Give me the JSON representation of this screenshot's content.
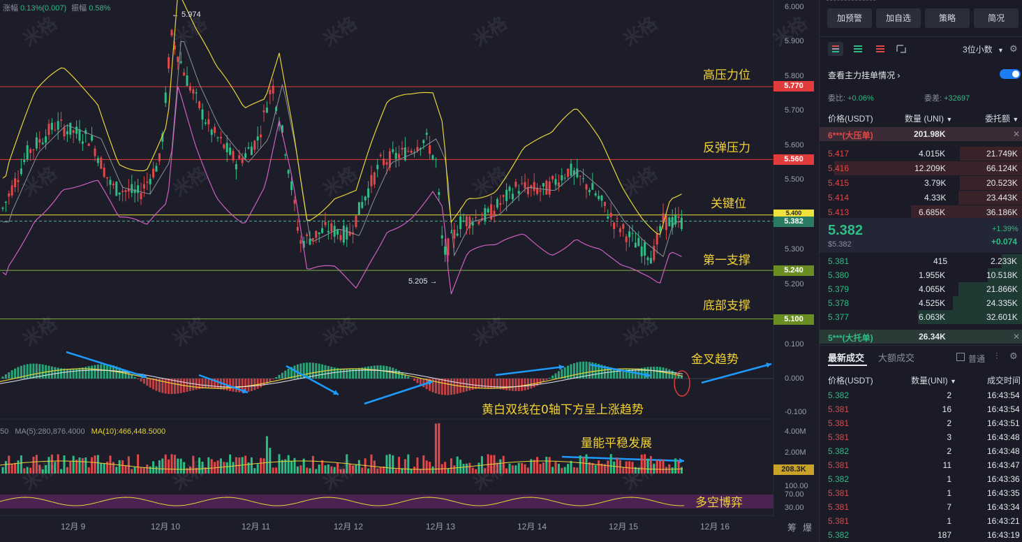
{
  "header": {
    "change_label": "涨幅",
    "change_value": "0.13%(0.007)",
    "amplitude_label": "振幅",
    "amplitude_value": "0.58%"
  },
  "chart": {
    "annotations": {
      "high_resistance": "高压力位",
      "rebound_resistance": "反弹压力",
      "key_level": "关键位",
      "first_support": "第一支撑",
      "bottom_support": "底部支撑",
      "golden_cross": "金叉趋势",
      "macd_note": "黄白双线在0轴下方呈上涨趋势",
      "volume_note": "量能平稳发展",
      "long_short": "多空博弈"
    },
    "high_marker": "← 5.974",
    "low_marker": "5.205 →",
    "price_axis": [
      "6.000",
      "5.900",
      "5.800",
      "5.700",
      "5.600",
      "5.500",
      "5.300",
      "5.200"
    ],
    "price_tags": {
      "p5770": "5.770",
      "p5560": "5.560",
      "p5400": "5.400",
      "p5382": "5.382",
      "p5240": "5.240",
      "p5100": "5.100"
    },
    "macd_axis": [
      "0.100",
      "0.000",
      "-0.100"
    ],
    "volume_legend_left": "50",
    "volume_ma5": "MA(5):280,876.4000",
    "volume_ma10": "MA(10):466,448.5000",
    "volume_axis": [
      "4.00M",
      "2.00M"
    ],
    "volume_tag": "208.3K",
    "kdj_axis": [
      "100.00",
      "70.00",
      "30.00"
    ],
    "x_axis": [
      "12月 9",
      "12月 10",
      "12月 11",
      "12月 12",
      "12月 13",
      "12月 14",
      "12月 15",
      "12月 16"
    ],
    "corner_labels": [
      "筹",
      "爆"
    ],
    "watermark": "米格",
    "colors": {
      "up": "#2dbd85",
      "down": "#e0484a",
      "ma_yellow": "#e8d43a",
      "ma_pink": "#d05fc0",
      "arrow": "#1e9bff"
    }
  },
  "panel": {
    "buttons": [
      "加预警",
      "加自选",
      "策略",
      "简况"
    ],
    "decimal_select": "3位小数",
    "main_orders_link": "查看主力挂单情况",
    "ratio_label": "委比:",
    "ratio_value": "+0.06%",
    "diff_label": "委差:",
    "diff_value": "+32697",
    "book_headers": [
      "价格(USDT)",
      "数量 (UNI)",
      "委托额"
    ],
    "big_ask": {
      "label": "6***(大压单)",
      "qty": "201.98K"
    },
    "asks": [
      {
        "price": "5.417",
        "qty": "4.015K",
        "amount": "21.749K"
      },
      {
        "price": "5.416",
        "qty": "12.209K",
        "amount": "66.124K"
      },
      {
        "price": "5.415",
        "qty": "3.79K",
        "amount": "20.523K"
      },
      {
        "price": "5.414",
        "qty": "4.33K",
        "amount": "23.443K"
      },
      {
        "price": "5.413",
        "qty": "6.685K",
        "amount": "36.186K"
      }
    ],
    "last_price": "5.382",
    "last_price_sub": "$5.382",
    "change_pct": "+1.39%",
    "change_abs": "+0.074",
    "bids": [
      {
        "price": "5.381",
        "qty": "415",
        "amount": "2.233K"
      },
      {
        "price": "5.380",
        "qty": "1.955K",
        "amount": "10.518K"
      },
      {
        "price": "5.379",
        "qty": "4.065K",
        "amount": "21.866K"
      },
      {
        "price": "5.378",
        "qty": "4.525K",
        "amount": "24.335K"
      },
      {
        "price": "5.377",
        "qty": "6.063K",
        "amount": "32.601K"
      }
    ],
    "big_bid": {
      "label": "5***(大托单)",
      "qty": "26.34K"
    },
    "trade_tabs": [
      "最新成交",
      "大额成交"
    ],
    "normal_label": "普通",
    "trade_headers": [
      "价格(USDT)",
      "数量(UNI)",
      "成交时间"
    ],
    "trades": [
      {
        "price": "5.382",
        "qty": "2",
        "time": "16:43:54",
        "side": "up"
      },
      {
        "price": "5.381",
        "qty": "16",
        "time": "16:43:54",
        "side": "down"
      },
      {
        "price": "5.381",
        "qty": "2",
        "time": "16:43:51",
        "side": "down"
      },
      {
        "price": "5.381",
        "qty": "3",
        "time": "16:43:48",
        "side": "down"
      },
      {
        "price": "5.382",
        "qty": "2",
        "time": "16:43:48",
        "side": "up"
      },
      {
        "price": "5.381",
        "qty": "11",
        "time": "16:43:47",
        "side": "down"
      },
      {
        "price": "5.382",
        "qty": "1",
        "time": "16:43:36",
        "side": "up"
      },
      {
        "price": "5.381",
        "qty": "1",
        "time": "16:43:35",
        "side": "down"
      },
      {
        "price": "5.381",
        "qty": "7",
        "time": "16:43:34",
        "side": "down"
      },
      {
        "price": "5.381",
        "qty": "1",
        "time": "16:43:21",
        "side": "down"
      },
      {
        "price": "5.382",
        "qty": "187",
        "time": "16:43:19",
        "side": "up"
      }
    ]
  }
}
